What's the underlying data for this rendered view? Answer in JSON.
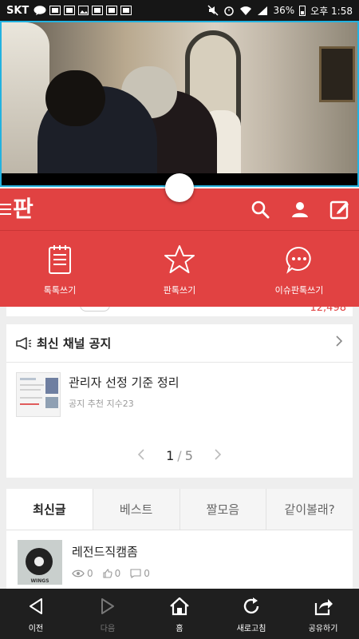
{
  "status_bar": {
    "carrier": "SKT",
    "battery": "36%",
    "time": "오후 1:58"
  },
  "appbar": {
    "logo": "판"
  },
  "write_panel": {
    "items": [
      {
        "label": "톡톡쓰기",
        "icon": "notepad-icon"
      },
      {
        "label": "판톡쓰기",
        "icon": "star-icon"
      },
      {
        "label": "이슈판톡쓰기",
        "icon": "chat-bubble-icon"
      }
    ]
  },
  "peek": {
    "count": "12,498"
  },
  "notice": {
    "title": "최신 채널 공지",
    "item_title": "관리자 선정 기준 정리",
    "item_sub": "공지 추천 지수23",
    "page_current": "1",
    "page_sep": "/",
    "page_total": "5"
  },
  "tabs": [
    "최신글",
    "베스트",
    "짤모음",
    "같이볼래?"
  ],
  "post": {
    "title": "레전드직캠좀",
    "thumb_text": "WINGS",
    "views": "0",
    "likes": "0",
    "comments": "0"
  },
  "bottom_nav": [
    {
      "label": "이전",
      "icon": "back-arrow-icon"
    },
    {
      "label": "다음",
      "icon": "forward-arrow-icon"
    },
    {
      "label": "홈",
      "icon": "home-icon"
    },
    {
      "label": "새로고침",
      "icon": "refresh-icon"
    },
    {
      "label": "공유하기",
      "icon": "share-icon"
    }
  ],
  "colors": {
    "brand_red": "#e14242",
    "video_border": "#22b2e0",
    "nav_bg": "#1f1f1f"
  }
}
